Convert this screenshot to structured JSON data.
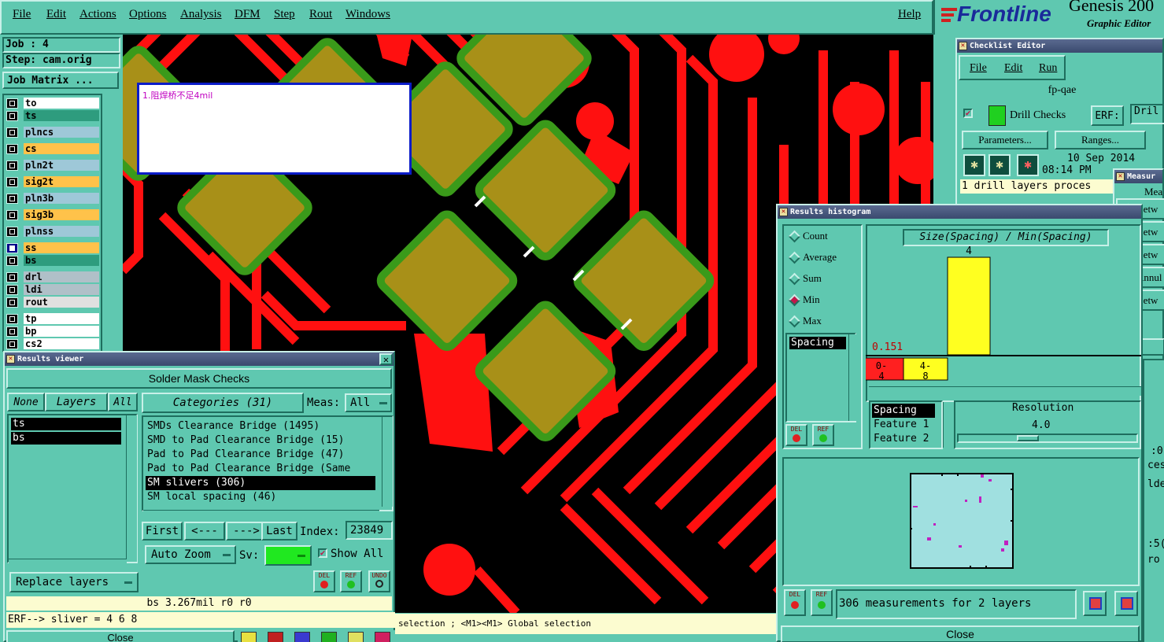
{
  "menubar": {
    "file": "File",
    "edit": "Edit",
    "actions": "Actions",
    "options": "Options",
    "analysis": "Analysis",
    "dfm": "DFM",
    "step": "Step",
    "rout": "Rout",
    "windows": "Windows",
    "help": "Help"
  },
  "brand": {
    "logo": "Frontline",
    "product": "Genesis 200",
    "subtitle": "Graphic Editor"
  },
  "job": {
    "job_label": "Job : 4",
    "step_label": "Step: cam.orig",
    "matrix_button": "Job Matrix ..."
  },
  "layers": [
    {
      "name": "to",
      "color": "#ffffff",
      "checked": false
    },
    {
      "name": "ts",
      "color": "#2e9c7e",
      "checked": false
    },
    {
      "name": "plncs",
      "color": "#9ec8d8",
      "checked": false
    },
    {
      "name": "cs",
      "color": "#ffc24a",
      "checked": false
    },
    {
      "name": "pln2t",
      "color": "#9ec8d8",
      "checked": false
    },
    {
      "name": "sig2t",
      "color": "#ffc24a",
      "checked": false
    },
    {
      "name": "pln3b",
      "color": "#9ec8d8",
      "checked": false
    },
    {
      "name": "sig3b",
      "color": "#ffc24a",
      "checked": false
    },
    {
      "name": "plnss",
      "color": "#9ec8d8",
      "checked": false
    },
    {
      "name": "ss",
      "color": "#ffc24a",
      "checked": true
    },
    {
      "name": "bs",
      "color": "#2e9c7e",
      "checked": false
    },
    {
      "name": "drl",
      "color": "#b0c0c8",
      "checked": false
    },
    {
      "name": "ldi",
      "color": "#b0c0c8",
      "checked": false
    },
    {
      "name": "rout",
      "color": "#e0e0e0",
      "checked": false
    },
    {
      "name": "tp",
      "color": "#ffffff",
      "checked": false
    },
    {
      "name": "bp",
      "color": "#ffffff",
      "checked": false
    },
    {
      "name": "cs2",
      "color": "#ffffff",
      "checked": false
    }
  ],
  "note": {
    "text": "1.阻焊桥不足4mil"
  },
  "results_viewer": {
    "title": "Results viewer",
    "heading": "Solder Mask Checks",
    "none_btn": "None",
    "layers_btn": "Layers",
    "all_btn": "All",
    "categories_label": "Categories (31)",
    "meas_label": "Meas:",
    "meas_value": "All",
    "layer_items": [
      "ts",
      "bs"
    ],
    "categories": [
      "SMDs Clearance Bridge (1495)",
      "SMD to Pad Clearance Bridge (15)",
      "Pad to Pad Clearance Bridge (47)",
      "Pad to Pad Clearance Bridge (Same",
      "SM slivers (306)",
      "SM local spacing (46)"
    ],
    "selected_category": 4,
    "first": "First",
    "prev": "<---",
    "next": "--->",
    "last": "Last",
    "index_label": "Index:",
    "index_value": "23849",
    "auto_zoom": "Auto Zoom",
    "sv_label": "Sv:",
    "show_all": "Show All",
    "replace_layers": "Replace layers",
    "del": "DEL",
    "ref": "REF",
    "undo": "UNDO",
    "status_line": "bs 3.267mil   r0   r0",
    "erf_line": "ERF--> sliver = 4 6 8",
    "close": "Close"
  },
  "status_bar": {
    "text": "selection ; <M1><M1> Global selection"
  },
  "checklist": {
    "title": "Checklist Editor",
    "menu_file": "File",
    "menu_edit": "Edit",
    "menu_run": "Run",
    "name": "fp-qae",
    "drill_checks": "Drill Checks",
    "erf_label": "ERF:",
    "erf_value": "Dril",
    "parameters": "Parameters...",
    "ranges": "Ranges...",
    "date": "10 Sep 2014",
    "time": "08:14 PM",
    "status": "1 drill layers proces"
  },
  "measure": {
    "title": "Measur",
    "header": "Mea",
    "items": [
      "Betw",
      "Betw",
      "Betw",
      "Annul",
      "Betw"
    ],
    "selected": 1
  },
  "histogram": {
    "title": "Results histogram",
    "options": [
      "Count",
      "Average",
      "Sum",
      "Min",
      "Max"
    ],
    "selected_option": 3,
    "list_items": [
      "Spacing"
    ],
    "graph_title": "Size(Spacing) / Min(Spacing)",
    "bar_value": "4",
    "min_value": "0.151",
    "bins": [
      {
        "label": "0-4",
        "color": "#ff2020"
      },
      {
        "label": "4-8",
        "color": "#ffff20"
      }
    ],
    "features": [
      "Spacing",
      "Feature 1",
      "Feature 2"
    ],
    "resolution_label": "Resolution",
    "resolution_value": "4.0",
    "summary": "306 measurements for 2 layers",
    "del": "DEL",
    "ref": "REF",
    "close": "Close"
  },
  "right_edge_fragments": [
    ":0",
    "ces",
    "lde",
    ":5(",
    "ro"
  ],
  "chart_data": {
    "type": "bar",
    "categories": [
      "0-4",
      "4-8"
    ],
    "values": [
      0,
      4
    ],
    "title": "Size(Spacing) / Min(Spacing)",
    "min_label": "0.151"
  }
}
